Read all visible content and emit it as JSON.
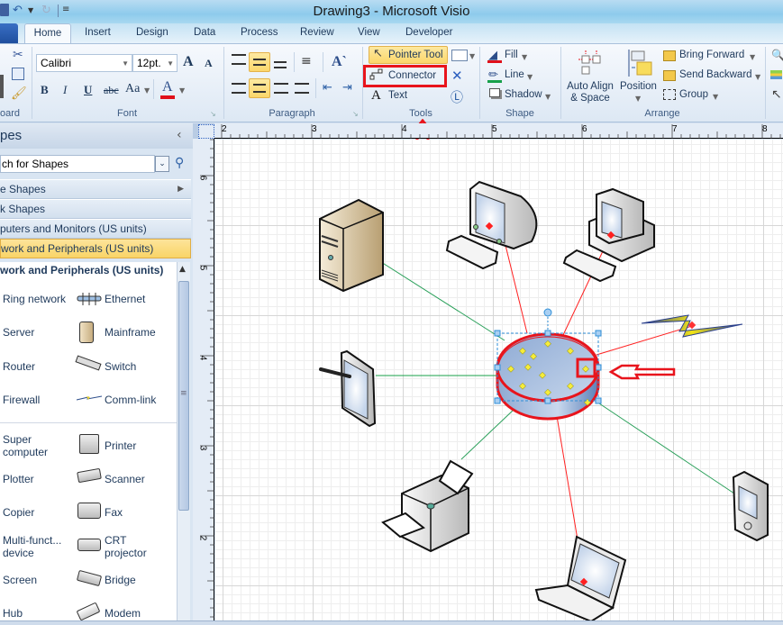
{
  "window": {
    "title": "Drawing3  -  Microsoft Visio"
  },
  "quick_access": {
    "save_icon": "save-icon",
    "undo_icon": "undo-icon",
    "redo_icon": "redo-icon",
    "customize_icon": "customize-qat-icon"
  },
  "tabs": [
    {
      "label": "Home",
      "active": true
    },
    {
      "label": "Insert"
    },
    {
      "label": "Design"
    },
    {
      "label": "Data"
    },
    {
      "label": "Process"
    },
    {
      "label": "Review"
    },
    {
      "label": "View"
    },
    {
      "label": "Developer"
    }
  ],
  "ribbon": {
    "clipboard": {
      "label": "oard"
    },
    "font": {
      "label": "Font",
      "font_name": "Calibri",
      "font_size": "12pt.",
      "bold": "B",
      "italic": "I",
      "underline": "U",
      "strike": "abc",
      "case": "Aa",
      "color_a": "A",
      "grow": "A",
      "shrink": "A"
    },
    "paragraph": {
      "label": "Paragraph"
    },
    "tools": {
      "label": "Tools",
      "pointer": "Pointer Tool",
      "connector": "Connector",
      "text": "Text"
    },
    "shape": {
      "label": "Shape",
      "fill": "Fill",
      "line": "Line",
      "shadow": "Shadow"
    },
    "arrange": {
      "label": "Arrange",
      "auto_align_1": "Auto Align",
      "auto_align_2": "& Space",
      "position": "Position",
      "bring_forward": "Bring Forward",
      "send_backward": "Send Backward",
      "group": "Group"
    }
  },
  "shapes_pane": {
    "title": "pes",
    "search_placeholder": "ch for Shapes",
    "stencils": [
      {
        "label": "e Shapes"
      },
      {
        "label": "k Shapes"
      },
      {
        "label": "puters and Monitors (US units)"
      },
      {
        "label": "work and Peripherals (US units)",
        "active": true
      }
    ],
    "stencil_title": "work and Peripherals (US units)",
    "masters_left": [
      {
        "label": "Ring network"
      },
      {
        "label": "Server"
      },
      {
        "label": "Router"
      },
      {
        "label": "Firewall"
      },
      {
        "label": "Super computer"
      },
      {
        "label": "Plotter"
      },
      {
        "label": "Copier"
      },
      {
        "label": "Multi-funct... device"
      },
      {
        "label": "Screen"
      },
      {
        "label": "Hub"
      }
    ],
    "masters_right": [
      {
        "label": "Ethernet"
      },
      {
        "label": "Mainframe"
      },
      {
        "label": "Switch"
      },
      {
        "label": "Comm-link"
      },
      {
        "label": "Printer"
      },
      {
        "label": "Scanner"
      },
      {
        "label": "Fax"
      },
      {
        "label": "CRT projector"
      },
      {
        "label": "Bridge"
      },
      {
        "label": "Modem"
      }
    ]
  },
  "ruler": {
    "horizontal": [
      "2",
      "3",
      "4",
      "5",
      "6",
      "7",
      "8"
    ],
    "vertical": [
      "6",
      "5",
      "4",
      "3",
      "2"
    ]
  },
  "diagram": {
    "shapes": [
      "Server tower",
      "CRT monitor PC",
      "Desktop PC",
      "Comm-link",
      "Tablet",
      "Ring network (selected)",
      "Printer",
      "Laptop",
      "PDA"
    ],
    "colors": {
      "selection_red": "#e8141c",
      "connector_red": "#ff2020",
      "connector_green": "#2aa05a",
      "ring_blue": "#9fb8dc",
      "handle_blue": "#3f8fd6"
    }
  }
}
